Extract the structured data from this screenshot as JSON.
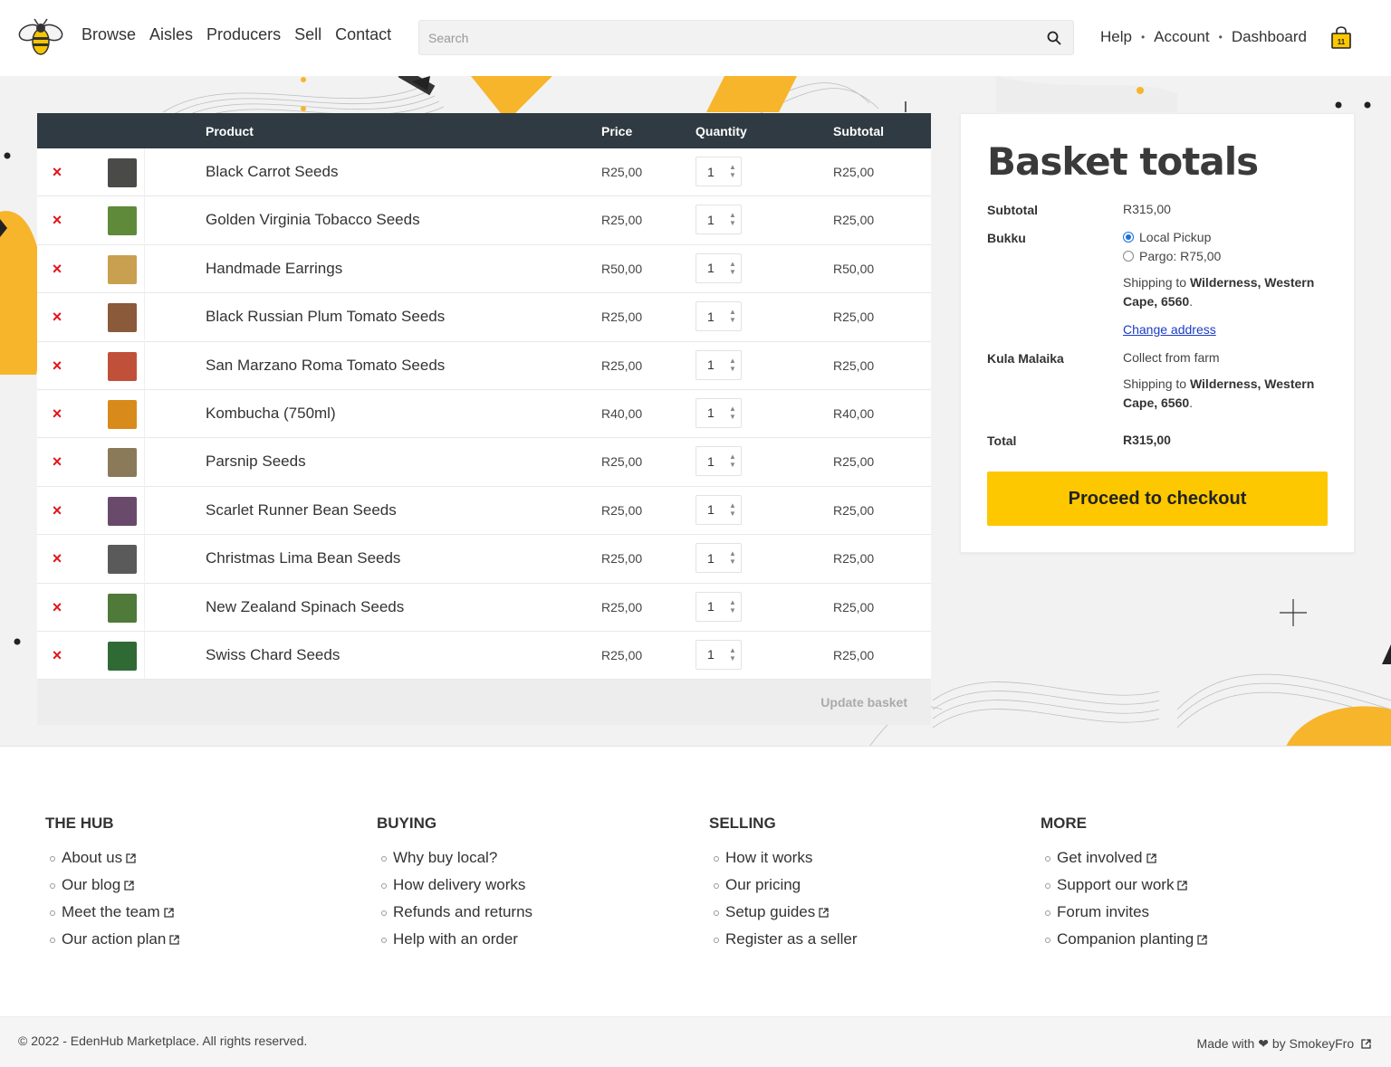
{
  "header": {
    "nav": [
      "Browse",
      "Aisles",
      "Producers",
      "Sell",
      "Contact"
    ],
    "search_placeholder": "Search",
    "right_nav": [
      "Help",
      "Account",
      "Dashboard"
    ],
    "cart_count": "11",
    "accent_color": "#fdc800"
  },
  "cart": {
    "columns": {
      "product": "Product",
      "price": "Price",
      "quantity": "Quantity",
      "subtotal": "Subtotal"
    },
    "remove_symbol": "×",
    "items": [
      {
        "name": "Black Carrot Seeds",
        "price": "R25,00",
        "qty": "1",
        "subtotal": "R25,00",
        "thumb_color": "#4a4a48"
      },
      {
        "name": "Golden Virginia Tobacco Seeds",
        "price": "R25,00",
        "qty": "1",
        "subtotal": "R25,00",
        "thumb_color": "#5e8a3a"
      },
      {
        "name": "Handmade Earrings",
        "price": "R50,00",
        "qty": "1",
        "subtotal": "R50,00",
        "thumb_color": "#c9a050"
      },
      {
        "name": "Black Russian Plum Tomato Seeds",
        "price": "R25,00",
        "qty": "1",
        "subtotal": "R25,00",
        "thumb_color": "#8a5a3a"
      },
      {
        "name": "San Marzano Roma Tomato Seeds",
        "price": "R25,00",
        "qty": "1",
        "subtotal": "R25,00",
        "thumb_color": "#c0503a"
      },
      {
        "name": "Kombucha (750ml)",
        "price": "R40,00",
        "qty": "1",
        "subtotal": "R40,00",
        "thumb_color": "#d88a1a"
      },
      {
        "name": "Parsnip Seeds",
        "price": "R25,00",
        "qty": "1",
        "subtotal": "R25,00",
        "thumb_color": "#8a7a5a"
      },
      {
        "name": "Scarlet Runner Bean Seeds",
        "price": "R25,00",
        "qty": "1",
        "subtotal": "R25,00",
        "thumb_color": "#6a4a6a"
      },
      {
        "name": "Christmas Lima Bean Seeds",
        "price": "R25,00",
        "qty": "1",
        "subtotal": "R25,00",
        "thumb_color": "#5a5a5a"
      },
      {
        "name": "New Zealand Spinach Seeds",
        "price": "R25,00",
        "qty": "1",
        "subtotal": "R25,00",
        "thumb_color": "#4f7a3a"
      },
      {
        "name": "Swiss Chard Seeds",
        "price": "R25,00",
        "qty": "1",
        "subtotal": "R25,00",
        "thumb_color": "#2f6a35"
      }
    ],
    "update_label": "Update basket"
  },
  "totals": {
    "title": "Basket totals",
    "subtotal_label": "Subtotal",
    "subtotal_value": "R315,00",
    "vendor1": {
      "name": "Bukku",
      "options": [
        "Local Pickup",
        "Pargo: R75,00"
      ],
      "selected": "Local Pickup",
      "shipping_prefix": "Shipping to ",
      "shipping_place": "Wilderness, Western",
      "shipping_place2": "Cape, 6560",
      "change_address": "Change address"
    },
    "vendor2": {
      "name": "Kula Malaika",
      "method": "Collect from farm",
      "shipping_prefix": "Shipping to ",
      "shipping_place": "Wilderness, Western",
      "shipping_place2": "Cape, 6560"
    },
    "total_label": "Total",
    "total_value": "R315,00",
    "checkout_label": "Proceed to checkout"
  },
  "footer": {
    "columns": [
      {
        "title": "THE HUB",
        "links": [
          {
            "label": "About us",
            "external": true
          },
          {
            "label": "Our blog",
            "external": true
          },
          {
            "label": "Meet the team",
            "external": true
          },
          {
            "label": "Our action plan",
            "external": true
          }
        ]
      },
      {
        "title": "BUYING",
        "links": [
          {
            "label": "Why buy local?",
            "external": false
          },
          {
            "label": "How delivery works",
            "external": false
          },
          {
            "label": "Refunds and returns",
            "external": false
          },
          {
            "label": "Help with an order",
            "external": false
          }
        ]
      },
      {
        "title": "SELLING",
        "links": [
          {
            "label": "How it works",
            "external": false
          },
          {
            "label": "Our pricing",
            "external": false
          },
          {
            "label": "Setup guides",
            "external": true
          },
          {
            "label": "Register as a seller",
            "external": false
          }
        ]
      },
      {
        "title": "MORE",
        "links": [
          {
            "label": "Get involved",
            "external": true
          },
          {
            "label": "Support our work",
            "external": true
          },
          {
            "label": "Forum invites",
            "external": false
          },
          {
            "label": "Companion planting",
            "external": true
          }
        ]
      }
    ],
    "copyright": "© 2022 - EdenHub Marketplace. All rights reserved.",
    "made_with_prefix": "Made with",
    "made_with_suffix": "by SmokeyFro"
  }
}
